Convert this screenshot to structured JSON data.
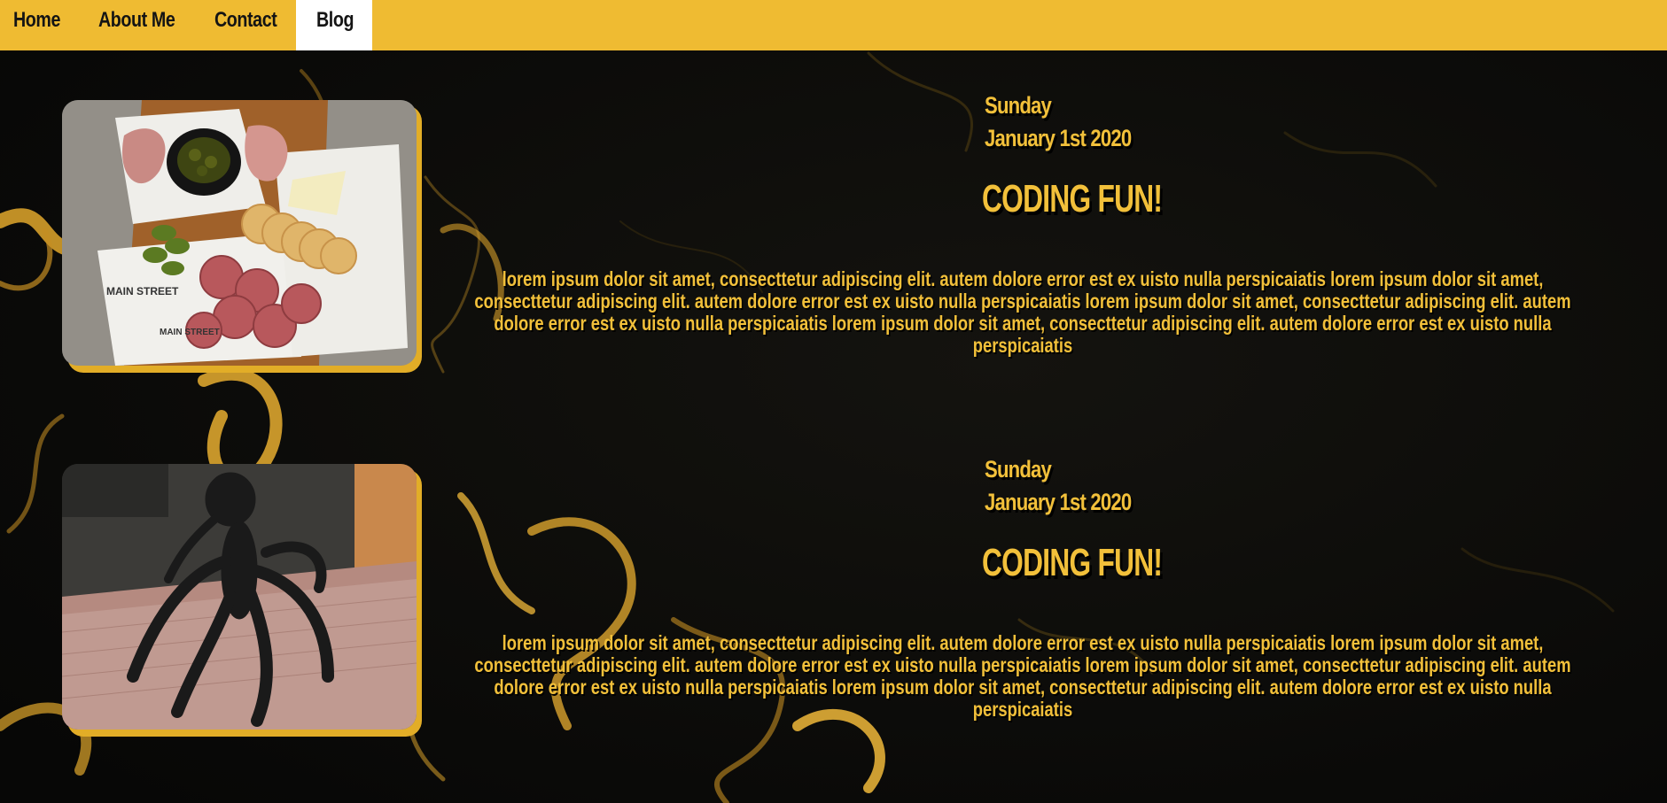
{
  "nav": {
    "items": [
      {
        "label": "Home"
      },
      {
        "label": "About Me"
      },
      {
        "label": "Contact"
      },
      {
        "label": "Blog",
        "active": true
      }
    ]
  },
  "colors": {
    "accent": "#efbb32",
    "text_accent": "#f2c03a",
    "background": "#0d0d0a",
    "active_tab": "#ffffff"
  },
  "posts": [
    {
      "image": "charcuterie-board-photo",
      "day": "Sunday",
      "date": "January 1st 2020",
      "title": "CODING FUN!",
      "body": "lorem ipsum dolor sit amet, consecttetur adipiscing elit. autem dolore error est ex uisto nulla perspicaiatis lorem ipsum dolor sit amet, consecttetur adipiscing elit. autem dolore error est ex uisto nulla perspicaiatis lorem ipsum dolor sit amet, consecttetur adipiscing elit. autem dolore error est ex uisto nulla perspicaiatis lorem ipsum dolor sit amet, consecttetur adipiscing elit. autem dolore error est ex uisto nulla perspicaiatis"
    },
    {
      "image": "spider-sculpture-photo",
      "day": "Sunday",
      "date": "January 1st 2020",
      "title": "CODING FUN!",
      "body": "lorem ipsum dolor sit amet, consecttetur adipiscing elit. autem dolore error est ex uisto nulla perspicaiatis lorem ipsum dolor sit amet, consecttetur adipiscing elit. autem dolore error est ex uisto nulla perspicaiatis lorem ipsum dolor sit amet, consecttetur adipiscing elit. autem dolore error est ex uisto nulla perspicaiatis lorem ipsum dolor sit amet, consecttetur adipiscing elit. autem dolore error est ex uisto nulla perspicaiatis"
    }
  ]
}
